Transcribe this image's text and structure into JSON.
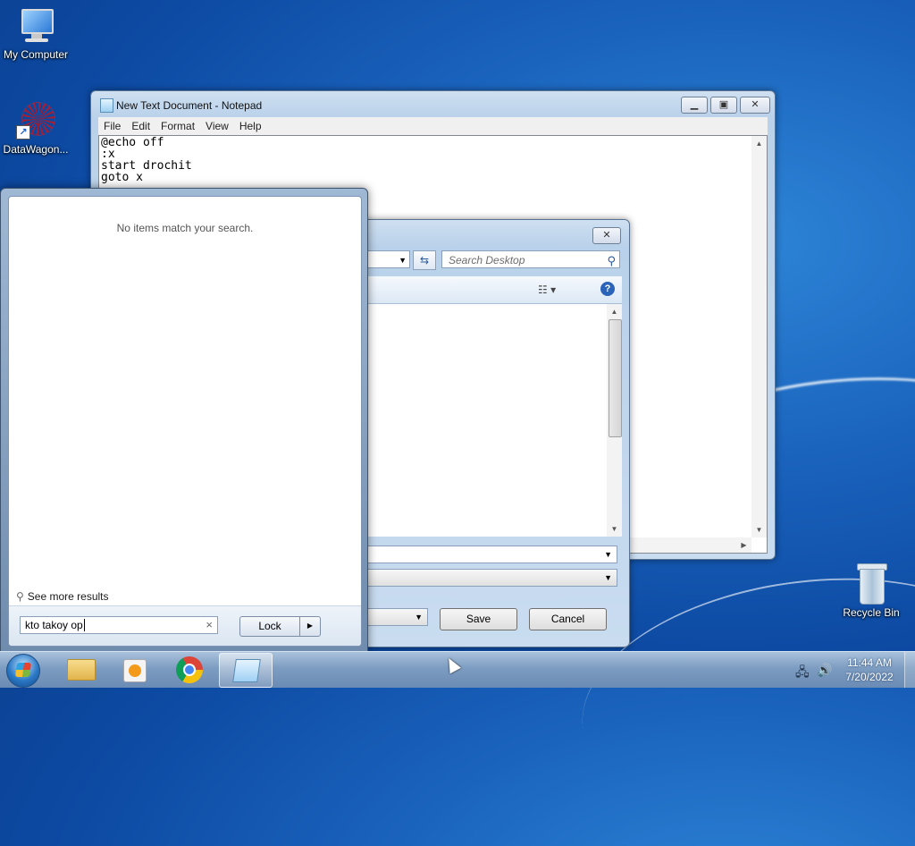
{
  "desktop": {
    "icons": [
      {
        "label": "My Computer"
      },
      {
        "label": "DataWagon..."
      },
      {
        "label": "Recycle Bin"
      }
    ]
  },
  "notepad": {
    "title": "New Text Document - Notepad",
    "menu": [
      "File",
      "Edit",
      "Format",
      "View",
      "Help"
    ],
    "content": "@echo off\n:x\nstart drochit\ngoto x"
  },
  "save_dialog": {
    "search_placeholder": "Search Desktop",
    "save_label": "Save",
    "cancel_label": "Cancel"
  },
  "start_menu": {
    "no_items": "No items match your search.",
    "see_more": "See more results",
    "search_value": "kto takoy op",
    "power_button": "Lock"
  },
  "taskbar": {
    "time": "11:44 AM",
    "date": "7/20/2022"
  },
  "colors": {
    "desktop_blue": "#1a63bd",
    "taskbar": "#7d9cc1",
    "help_blue": "#2a63b8"
  }
}
